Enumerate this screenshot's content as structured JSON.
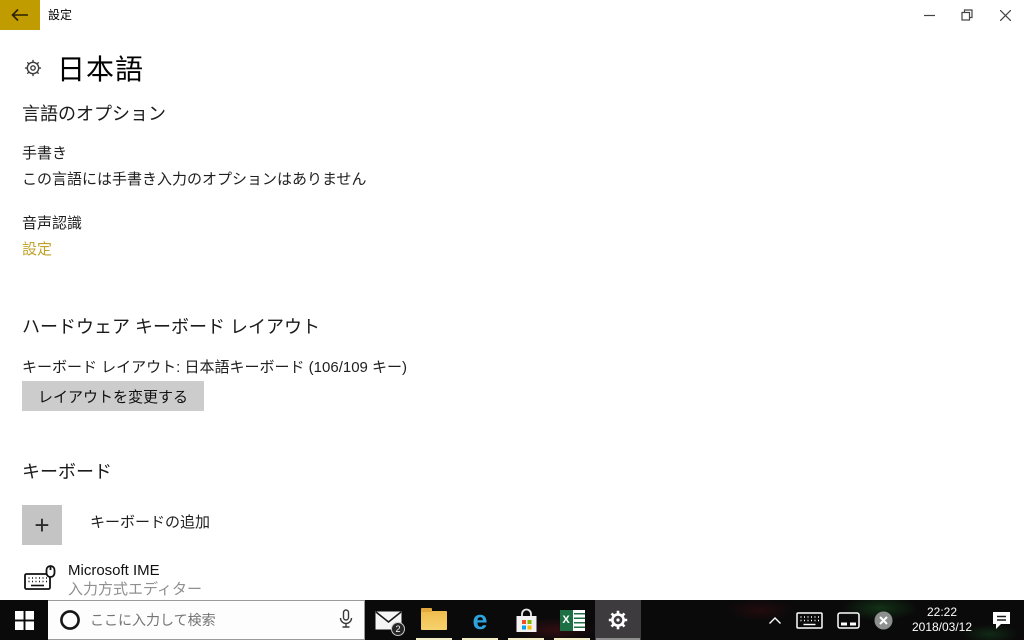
{
  "accent": "#c19c00",
  "titlebar": {
    "title": "設定"
  },
  "page": {
    "title": "日本語",
    "lang_options_heading": "言語のオプション",
    "handwriting_label": "手書き",
    "handwriting_status": "この言語には手書き入力のオプションはありません",
    "speech_label": "音声認識",
    "speech_settings_link": "設定",
    "hardware_heading": "ハードウェア キーボード レイアウト",
    "layout_info": "キーボード レイアウト: 日本語キーボード (106/109 キー)",
    "change_layout_button": "レイアウトを変更する",
    "keyboards_heading": "キーボード",
    "add_keyboard_label": "キーボードの追加",
    "ime_name": "Microsoft IME",
    "ime_description": "入力方式エディター"
  },
  "icons": {
    "plus": "+",
    "edge_glyph": "e",
    "excel_glyph": "X"
  },
  "taskbar": {
    "search_placeholder": "ここに入力して検索",
    "mail_badge": "2",
    "apps": [
      "mail",
      "file-explorer",
      "edge",
      "store",
      "excel",
      "settings"
    ],
    "tray_time": "22:22",
    "tray_date": "2018/03/12"
  }
}
